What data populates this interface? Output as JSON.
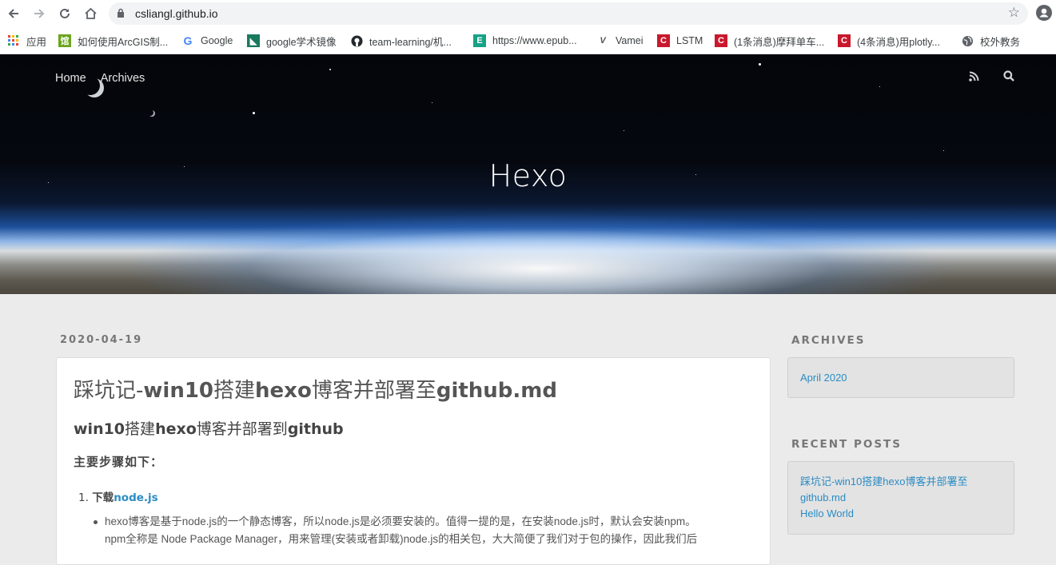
{
  "browser": {
    "url": "csliangl.github.io",
    "bookmarks": [
      {
        "label": "应用",
        "icon": "apps-grid-icon",
        "color": "#d93025"
      },
      {
        "label": "如何使用ArcGIS制...",
        "icon": "library-icon",
        "color": "#6aa51c"
      },
      {
        "label": "Google",
        "icon": "google-icon",
        "color": "#4285f4"
      },
      {
        "label": "google学术镜像",
        "icon": "scholar-icon",
        "color": "#1a7a5e"
      },
      {
        "label": "team-learning/机...",
        "icon": "github-icon",
        "color": "#24292e"
      },
      {
        "label": "https://www.epub...",
        "icon": "epub-icon",
        "color": "#17a185"
      },
      {
        "label": "Vamei",
        "icon": "vamei-icon",
        "color": "#555555"
      },
      {
        "label": "LSTM",
        "icon": "csdn-icon",
        "color": "#c9182d"
      },
      {
        "label": "(1条消息)摩拜单车...",
        "icon": "csdn-icon",
        "color": "#c9182d"
      },
      {
        "label": "(4条消息)用plotly...",
        "icon": "csdn-icon",
        "color": "#c9182d"
      },
      {
        "label": "校外教务",
        "icon": "globe-icon",
        "color": "#5f6368"
      }
    ]
  },
  "site": {
    "nav": [
      "Home",
      "Archives"
    ],
    "title": "Hexo",
    "icons": [
      "rss-icon",
      "search-icon"
    ]
  },
  "post": {
    "date": "2020-04-19",
    "title_prefix": "踩坑记-",
    "title_bold": "win10",
    "title_mid": "搭建",
    "title_bold2": "hexo",
    "title_mid2": "博客并部署至",
    "title_bold3": "github.md",
    "heading_bold1": "win10",
    "heading_mid1": "搭建",
    "heading_bold2": "hexo",
    "heading_mid2": "博客并部署到",
    "heading_bold3": "github",
    "subheading": "主要步骤如下：",
    "step_number": "1.",
    "step_prefix": "下载",
    "step_link": "node.js",
    "bullet_line1": "hexo博客是基于node.js的一个静态博客，所以node.js是必须要安装的。值得一提的是，在安装node.js时，默认会安装npm。",
    "bullet_line2": "npm全称是 Node Package Manager，用来管理(安装或者卸载)node.js的相关包，大大简便了我们对于包的操作，因此我们后"
  },
  "sidebar": {
    "archives_title": "ARCHIVES",
    "archives": [
      "April 2020"
    ],
    "recent_title": "RECENT POSTS",
    "recent": [
      "踩坑记-win10搭建hexo博客并部署至",
      "github.md",
      "Hello World"
    ]
  }
}
